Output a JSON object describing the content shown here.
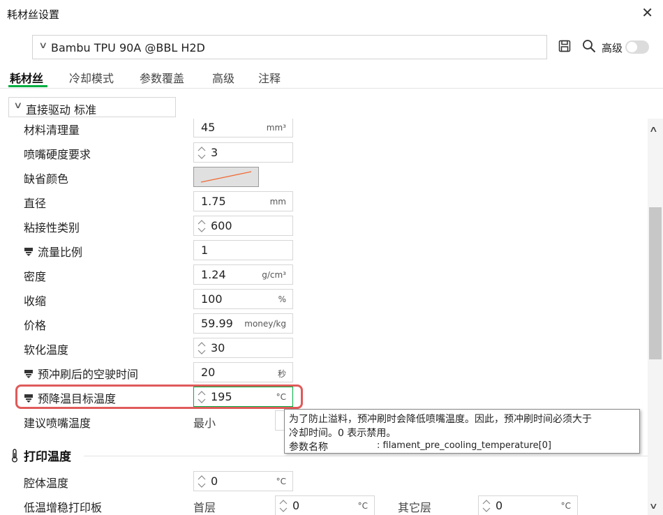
{
  "window": {
    "title": "耗材丝设置",
    "close": "✕"
  },
  "preset": {
    "name": "Bambu TPU 90A @BBL H2D"
  },
  "toolbar": {
    "advanced_label": "高级",
    "advanced_on": false
  },
  "tabs": [
    "耗材丝",
    "冷却模式",
    "参数覆盖",
    "高级",
    "注释"
  ],
  "active_tab": "耗材丝",
  "group": {
    "label": "直接驱动 标准"
  },
  "rows": [
    {
      "label": "材料清理量",
      "value": "45",
      "unit": "mm³",
      "nozzle": false
    },
    {
      "label": "喷嘴硬度要求",
      "value": "3",
      "unit": "",
      "nozzle": false,
      "spin": true
    },
    {
      "label": "缺省颜色",
      "value": "",
      "unit": "",
      "nozzle": false
    },
    {
      "label": "直径",
      "value": "1.75",
      "unit": "mm",
      "nozzle": false
    },
    {
      "label": "粘接性类别",
      "value": "600",
      "unit": "",
      "nozzle": false,
      "spin": true
    },
    {
      "label": "流量比例",
      "value": "1",
      "unit": "",
      "nozzle": true
    },
    {
      "label": "密度",
      "value": "1.24",
      "unit": "g/cm³",
      "nozzle": false
    },
    {
      "label": "收缩",
      "value": "100",
      "unit": "%",
      "nozzle": false
    },
    {
      "label": "价格",
      "value": "59.99",
      "unit": "money/kg",
      "nozzle": false
    },
    {
      "label": "软化温度",
      "value": "30",
      "unit": "",
      "nozzle": false,
      "spin": true
    },
    {
      "label": "预冲刷后的空驶时间",
      "value": "20",
      "unit": "秒",
      "nozzle": true
    },
    {
      "label": "预降温目标温度",
      "value": "195",
      "unit": "°C",
      "nozzle": true,
      "spin": true
    },
    {
      "label": "建议喷嘴温度",
      "value": "",
      "unit": "",
      "nozzle": false
    }
  ],
  "suggested_min_label": "最小",
  "tooltip": {
    "line1": "为了防止溢料，预冲刷时会降低喷嘴温度。因此，预冲刷时间必须大于",
    "line2": "冷却时间。0 表示禁用。",
    "param_key": "参数名称",
    "param_value": ": filament_pre_cooling_temperature[0]"
  },
  "print_temp": {
    "header": "打印温度",
    "chamber_label": "腔体温度",
    "chamber_value": "0",
    "chamber_unit": "°C",
    "plate_label": "低温增稳打印板",
    "first_layer_label": "首层",
    "first_layer_value": "0",
    "first_layer_unit": "°C",
    "other_layers_label": "其它层",
    "other_layers_value": "0",
    "other_layers_unit": "°C"
  },
  "colors": {
    "accent": "#00ae42",
    "highlight": "#e05a5a",
    "swatch_line": "#f06a35"
  }
}
